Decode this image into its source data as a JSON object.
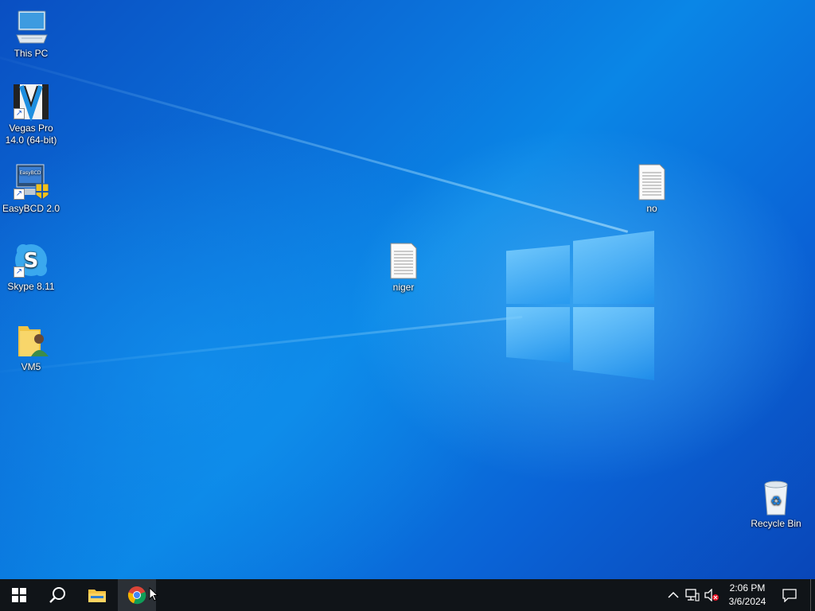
{
  "desktop": {
    "icons_left": [
      {
        "label": "This PC"
      },
      {
        "label": "Vegas Pro 14.0 (64-bit)"
      },
      {
        "label": "EasyBCD 2.0"
      },
      {
        "label": "Skype 8.11"
      },
      {
        "label": "VM5"
      }
    ],
    "file_niger": {
      "label": "niger"
    },
    "file_no": {
      "label": "no"
    },
    "recycle_bin": {
      "label": "Recycle Bin"
    },
    "easybcd_icon_text": "EasyBCD"
  },
  "taskbar": {
    "clock_time": "2:06 PM",
    "clock_date": "3/6/2024",
    "buttons": [
      "start-button",
      "search-button",
      "file-explorer-button",
      "chrome-button"
    ],
    "tray": [
      "show-hidden-icons",
      "network-icon",
      "volume-muted-icon",
      "action-center-icon"
    ]
  },
  "colors": {
    "taskbar": "#101418",
    "desktop_accent": "#0a63d6"
  }
}
